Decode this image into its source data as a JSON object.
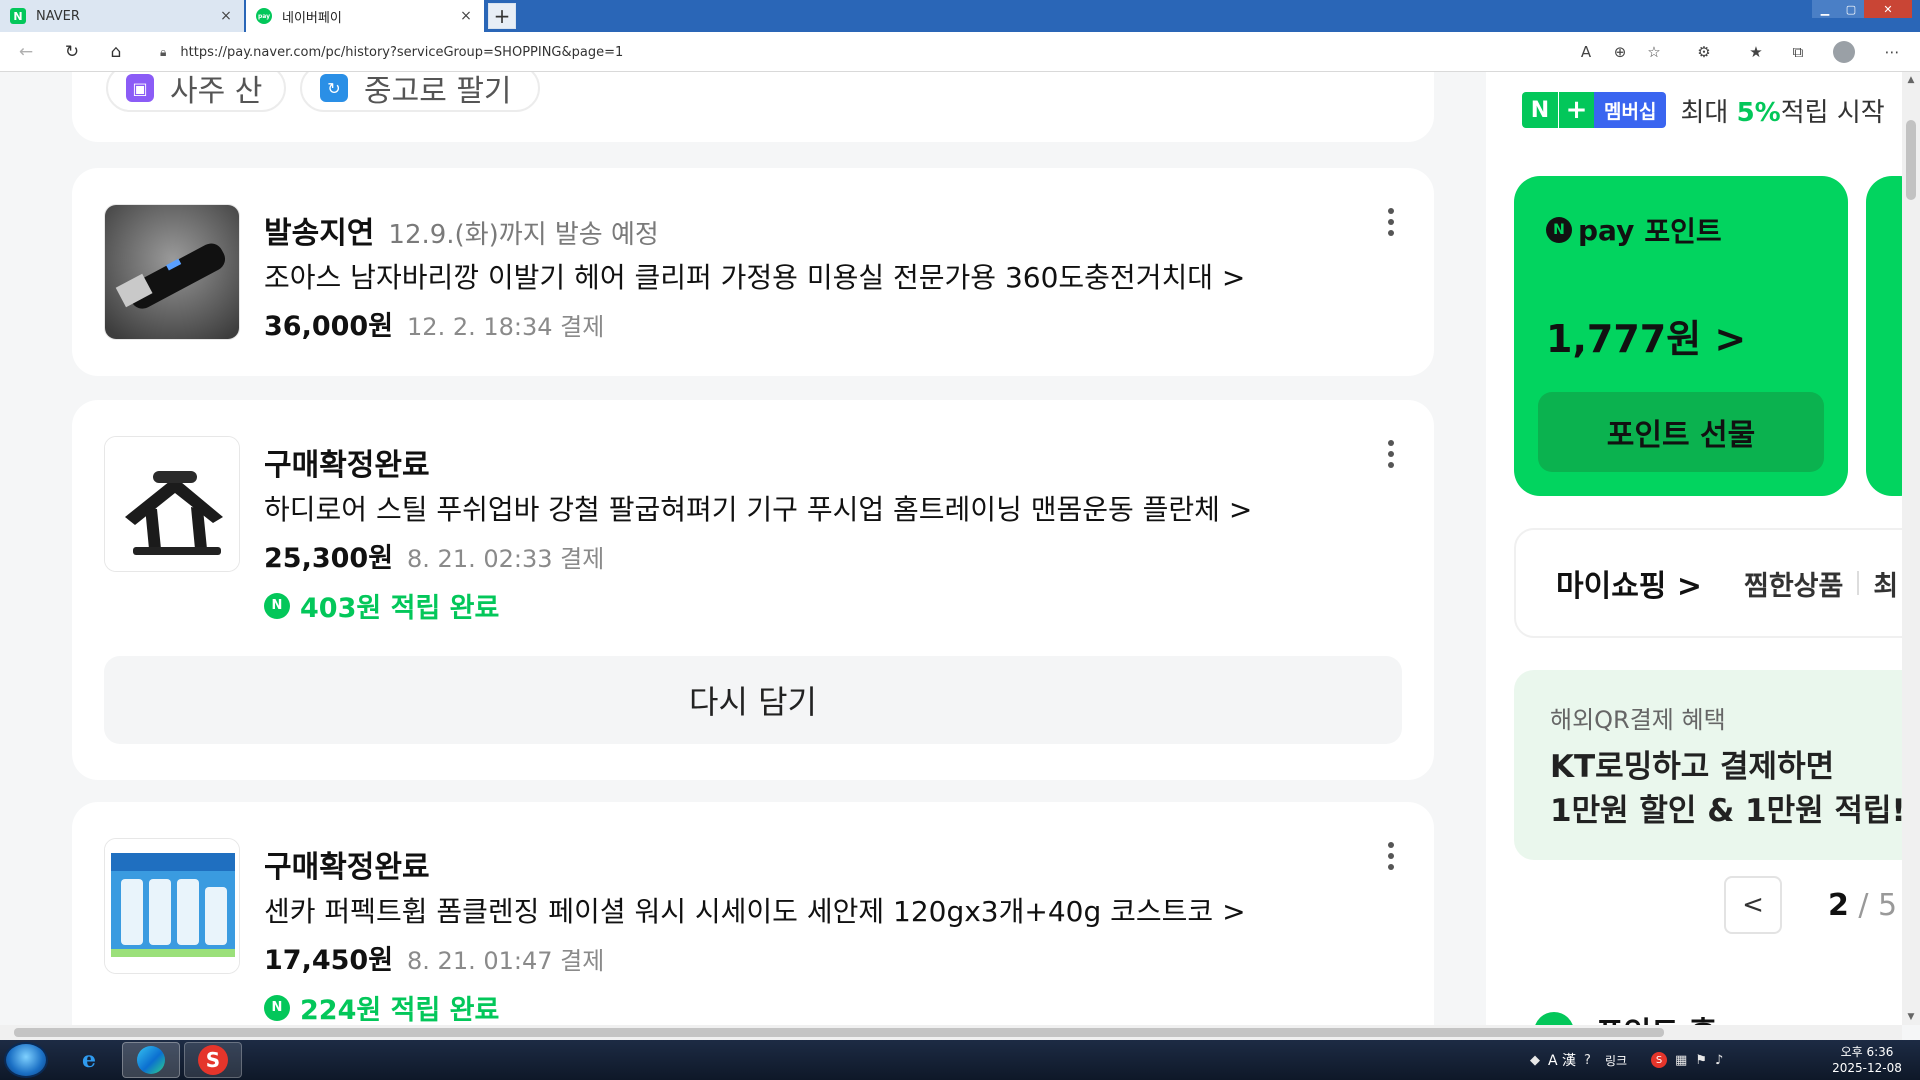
{
  "browser": {
    "tabs": [
      {
        "title": "NAVER",
        "close": "×"
      },
      {
        "title": "네이버페이",
        "close": "×"
      }
    ],
    "new_tab": "+",
    "url": "https://pay.naver.com/pc/history?serviceGroup=SHOPPING&page=1"
  },
  "top_card": {
    "chips": [
      "사주 산",
      "중고로 팔기"
    ]
  },
  "orders": [
    {
      "status": "발송지연",
      "status_sub": "12.9.(화)까지 발송 예정",
      "name": "조아스 남자바리깡 이발기 헤어 클리퍼 가정용 미용실 전문가용 360도충전거치대 >",
      "price": "36,000원",
      "paid": "12. 2. 18:34 결제"
    },
    {
      "status": "구매확정완료",
      "name": "하디로어 스틸 푸쉬업바 강철 팔굽혀펴기 기구 푸시업 홈트레이닝 맨몸운동 플란체 >",
      "price": "25,300원",
      "paid": "8. 21. 02:33 결제",
      "reward": "403원 적립 완료",
      "action": "다시 담기"
    },
    {
      "status": "구매확정완료",
      "name": "센카 퍼펙트휩 폼클렌징 페이셜 워시 시세이도 세안제 120gx3개+40g 코스트코 >",
      "price": "17,450원",
      "paid": "8. 21. 01:47 결제",
      "reward": "224원 적립 완료"
    }
  ],
  "sidebar": {
    "membership": {
      "badge_n": "N",
      "badge_plus": "+",
      "badge_label": "멤버십",
      "text_pre": "최대 ",
      "text_highlight": "5%",
      "text_post": "적립 시작"
    },
    "npay": {
      "logo_n": "N",
      "logo_word": "pay",
      "logo_label": "포인트",
      "amount": "1,777원 >",
      "gift_button": "포인트 선물"
    },
    "myshopping": {
      "title": "마이쇼핑 >",
      "wish": "찜한상품",
      "more": "최"
    },
    "promo": {
      "sub": "해외QR결제 혜택",
      "title": "KT로밍하고 결제하면\n1만원 할인 & 1만원 적립!"
    },
    "pager": {
      "prev": "<",
      "current": "2",
      "total": " / 5"
    },
    "peek_text": "포인트 홈"
  },
  "taskbar": {
    "tray_ime": "A 漢",
    "tray_link": "링크",
    "clock_time": "오후 6:36",
    "clock_date": "2025-12-08"
  },
  "colors": {
    "naver_green": "#03c75a",
    "npay_card": "#02d45f",
    "membership_blue": "#3a65f0",
    "promo_bg": "#eaf7ed"
  }
}
